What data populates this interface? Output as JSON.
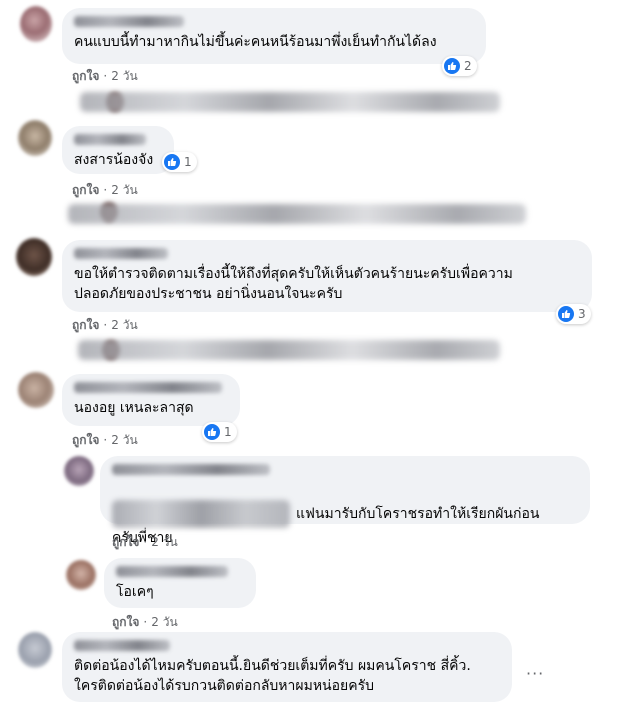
{
  "comments": [
    {
      "text": "คนแบบนี้ทำมาหากินไม่ขึ้นค่ะคนหนีร้อนมาพึ่งเย็นทำกันได้ลง",
      "like": "ถูกใจ",
      "time": "2 วัน",
      "reactions": "2"
    },
    {
      "text": "สงสารน้องจัง",
      "like": "ถูกใจ",
      "time": "2 วัน",
      "reactions": "1"
    },
    {
      "text": "ขอให้ตำรวจติดตามเรื่องนี้ให้ถึงที่สุดครับให้เห็นตัวคนร้ายนะครับเพื่อความ\nปลอดภัยของประชาชน อย่านิ่งนอนใจนะครับ",
      "like": "ถูกใจ",
      "time": "2 วัน",
      "reactions": "3"
    },
    {
      "text": "นองอยู เหนละลาสุด",
      "like": "ถูกใจ",
      "time": "2 วัน",
      "reactions": "1"
    },
    {
      "text": "แฟนมารับกับโคราชรอทำให้เรียกผันก่อน\nครับพี่ชาย",
      "like": "ถูกใจ",
      "time": "2 วัน"
    },
    {
      "text": "โอเคๆ",
      "like": "ถูกใจ",
      "time": "2 วัน"
    },
    {
      "text": "ติดต่อน้องได้ไหมครับตอนนี้.ยินดีช่วยเต็มที่ครับ ผมคนโคราช สี่คิ้ว.\nใครติดต่อน้องได้รบกวนติดต่อกลับหาผมหน่อยครับ"
    }
  ],
  "icons": {
    "like_badge": "thumbs-up-icon",
    "more": "more-options-icon"
  },
  "colors": {
    "bubble": "#f0f2f5",
    "like_blue": "#1877f2",
    "meta": "#65676b"
  }
}
